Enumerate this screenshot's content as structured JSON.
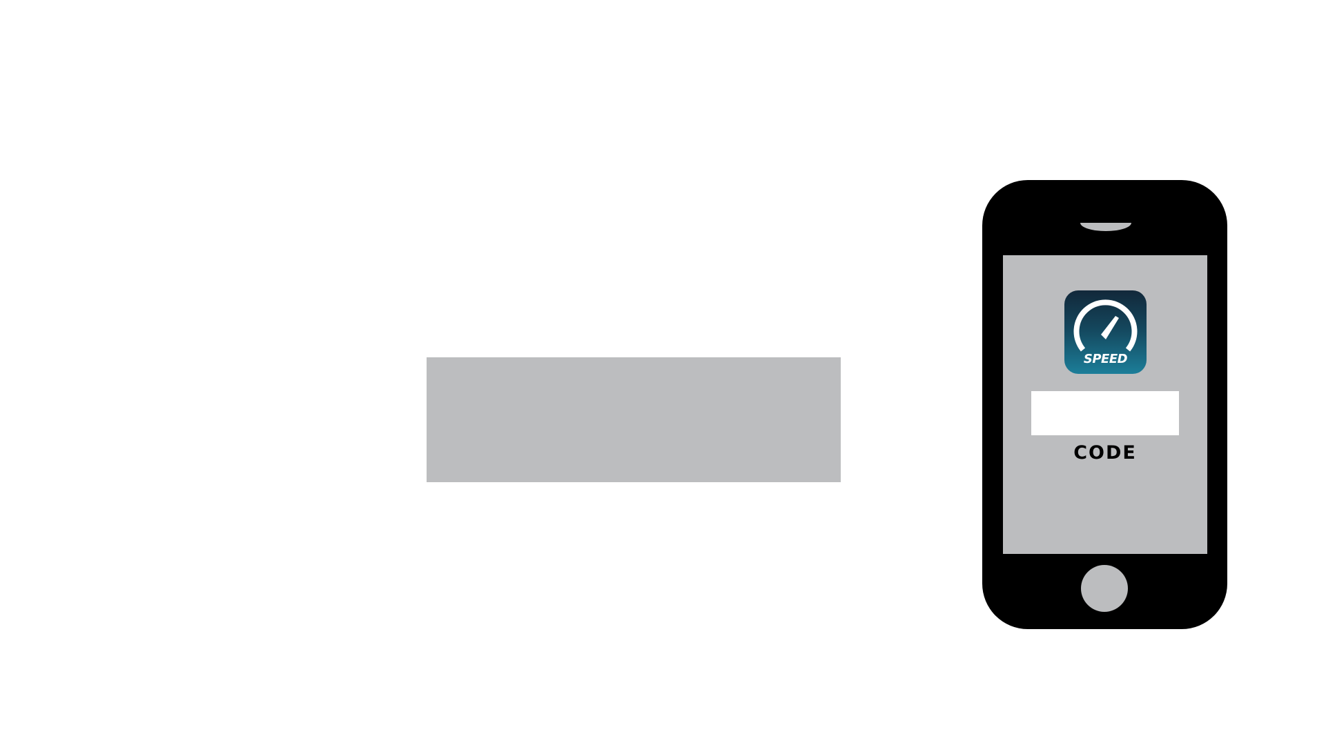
{
  "colors": {
    "background": "#ffffff",
    "placeholder_gray": "#bcbdbf",
    "phone_body": "#000000",
    "app_icon_top": "#12283a",
    "app_icon_bottom": "#1c7e99"
  },
  "phone": {
    "app_icon": {
      "icon": "speedometer-icon",
      "label": "SPEED"
    },
    "code_field": {
      "value": ""
    },
    "code_label": "CODE",
    "home_button_icon": "home-button"
  }
}
